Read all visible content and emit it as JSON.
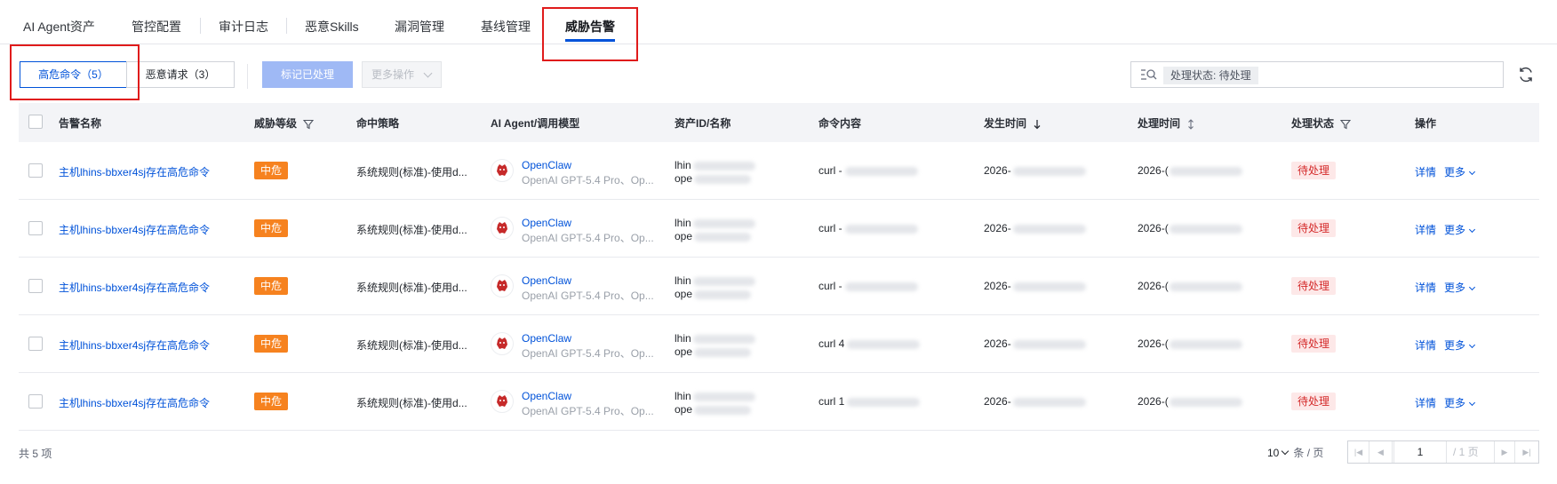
{
  "tabs": [
    {
      "label": "AI Agent资产"
    },
    {
      "label": "管控配置"
    },
    {
      "label": "审计日志"
    },
    {
      "label": "恶意Skills"
    },
    {
      "label": "漏洞管理"
    },
    {
      "label": "基线管理"
    },
    {
      "label": "威胁告警",
      "active": true
    }
  ],
  "toolbar": {
    "seg_high_risk": "高危命令（5）",
    "seg_malicious": "恶意请求（3）",
    "mark_processed": "标记已处理",
    "more_actions": "更多操作",
    "search_tag": "处理状态: 待处理"
  },
  "table": {
    "columns": [
      "告警名称",
      "威胁等级",
      "命中策略",
      "AI Agent/调用模型",
      "资产ID/名称",
      "命令内容",
      "发生时间",
      "处理时间",
      "处理状态",
      "操作"
    ],
    "rows": [
      {
        "alert_name": "主机lhins-bbxer4sj存在高危命令",
        "level": "中危",
        "policy": "系统规则(标准)-使用d...",
        "agent_name": "OpenClaw",
        "agent_model": "OpenAI GPT-5.4 Pro、Op...",
        "asset_line1": "lhin",
        "asset_line2": "ope",
        "command": "curl -",
        "occurred": "2026-",
        "processed": "2026-(",
        "status": "待处理",
        "op_detail": "详情",
        "op_more": "更多"
      },
      {
        "alert_name": "主机lhins-bbxer4sj存在高危命令",
        "level": "中危",
        "policy": "系统规则(标准)-使用d...",
        "agent_name": "OpenClaw",
        "agent_model": "OpenAI GPT-5.4 Pro、Op...",
        "asset_line1": "lhin",
        "asset_line2": "ope",
        "command": "curl -",
        "occurred": "2026-",
        "processed": "2026-(",
        "status": "待处理",
        "op_detail": "详情",
        "op_more": "更多"
      },
      {
        "alert_name": "主机lhins-bbxer4sj存在高危命令",
        "level": "中危",
        "policy": "系统规则(标准)-使用d...",
        "agent_name": "OpenClaw",
        "agent_model": "OpenAI GPT-5.4 Pro、Op...",
        "asset_line1": "lhin",
        "asset_line2": "ope",
        "command": "curl -",
        "occurred": "2026-",
        "processed": "2026-(",
        "status": "待处理",
        "op_detail": "详情",
        "op_more": "更多"
      },
      {
        "alert_name": "主机lhins-bbxer4sj存在高危命令",
        "level": "中危",
        "policy": "系统规则(标准)-使用d...",
        "agent_name": "OpenClaw",
        "agent_model": "OpenAI GPT-5.4 Pro、Op...",
        "asset_line1": "lhin",
        "asset_line2": "ope",
        "command": "curl 4",
        "occurred": "2026-",
        "processed": "2026-(",
        "status": "待处理",
        "op_detail": "详情",
        "op_more": "更多"
      },
      {
        "alert_name": "主机lhins-bbxer4sj存在高危命令",
        "level": "中危",
        "policy": "系统规则(标准)-使用d...",
        "agent_name": "OpenClaw",
        "agent_model": "OpenAI GPT-5.4 Pro、Op...",
        "asset_line1": "lhin",
        "asset_line2": "ope",
        "command": "curl 1",
        "occurred": "2026-",
        "processed": "2026-(",
        "status": "待处理",
        "op_detail": "详情",
        "op_more": "更多"
      }
    ]
  },
  "footer": {
    "total": "共 5 项",
    "page_size": "10",
    "page_size_unit": "条 / 页",
    "current_page": "1",
    "total_pages": "/ 1 页"
  },
  "icons": {
    "filter": "filter-icon",
    "sort_desc": "arrow-down-icon",
    "sort_both": "sort-icon",
    "refresh": "refresh-icon",
    "search": "search-icon",
    "agent_logo": "openclaw-logo-icon"
  },
  "colors": {
    "accent": "#0052d9",
    "level_medium": "#f6821f",
    "status_pending_bg": "#fde8e8",
    "status_pending_text": "#d42a2a",
    "highlight_box": "#e01b1b"
  }
}
